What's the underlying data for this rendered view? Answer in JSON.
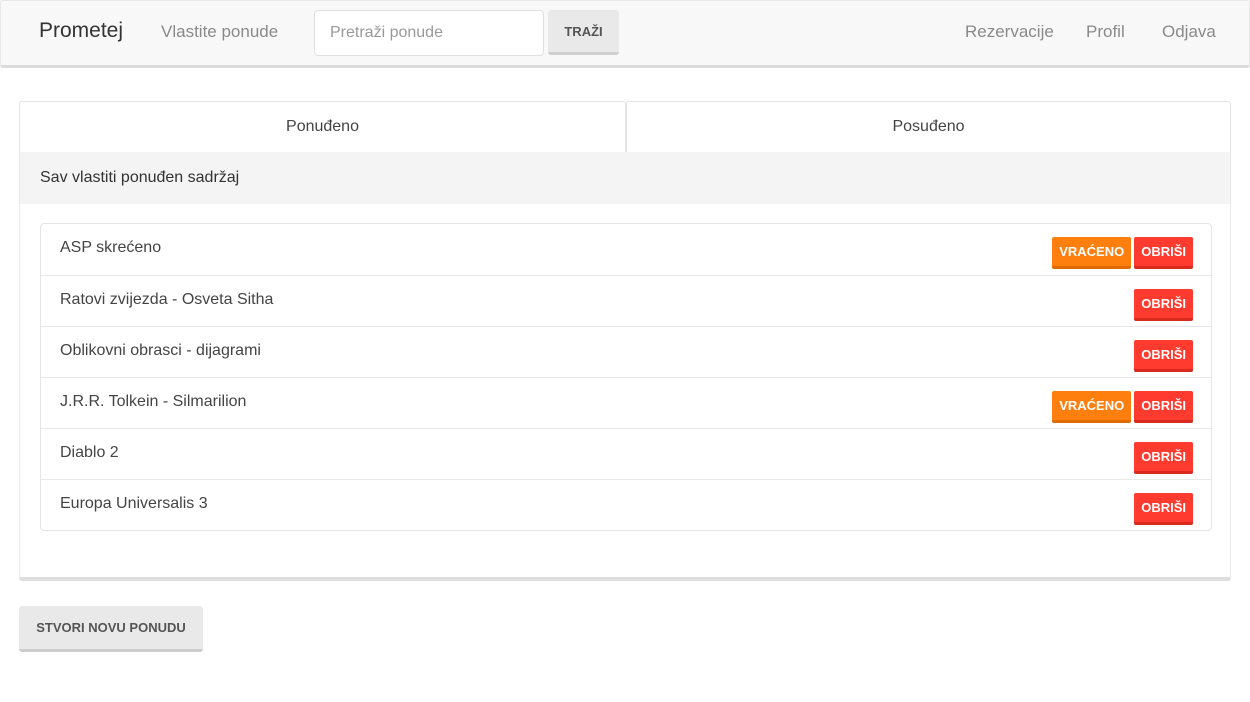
{
  "navbar": {
    "brand": "Prometej",
    "own_offers": "Vlastite ponude",
    "search_placeholder": "Pretraži ponude",
    "search_button": "TRAŽI",
    "reservations": "Rezervacije",
    "profile": "Profil",
    "logout": "Odjava"
  },
  "tabs": [
    "Ponuđeno",
    "Posuđeno"
  ],
  "panel": {
    "heading": "Sav vlastiti ponuđen sadržaj",
    "returned_label": "VRAĆENO",
    "delete_label": "OBRIŠI",
    "items": [
      {
        "title": "ASP skrećeno",
        "returned": true
      },
      {
        "title": "Ratovi zvijezda - Osveta Sitha",
        "returned": false
      },
      {
        "title": "Oblikovni obrasci - dijagrami",
        "returned": false
      },
      {
        "title": "J.R.R. Tolkein - Silmarilion",
        "returned": true
      },
      {
        "title": "Diablo 2",
        "returned": false
      },
      {
        "title": "Europa Universalis 3",
        "returned": false
      }
    ]
  },
  "create_button": "STVORI NOVU PONUDU",
  "colors": {
    "returned": "#ff7f0e",
    "delete": "#ff3b30"
  }
}
